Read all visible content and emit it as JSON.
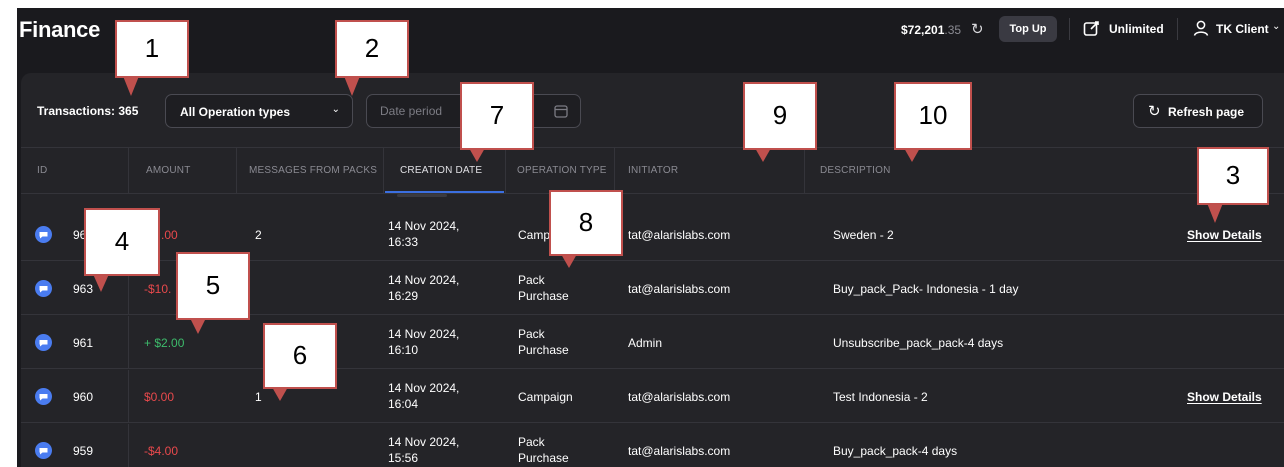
{
  "header": {
    "title": "Finance",
    "balance_main": "$72,201",
    "balance_cents": ".35",
    "topup_label": "Top Up",
    "plan_label": "Unlimited",
    "user_label": "TK Client"
  },
  "toolbar": {
    "transactions_label": "Transactions: 365",
    "operation_select_value": "All Operation types",
    "date_placeholder": "Date period",
    "refresh_label": "Refresh page"
  },
  "table": {
    "columns": [
      "ID",
      "AMOUNT",
      "MESSAGES FROM PACKS",
      "CREATION DATE",
      "OPERATION TYPE",
      "INITIATOR",
      "DESCRIPTION"
    ],
    "show_details_label": "Show Details",
    "rows": [
      {
        "id": "96",
        "amount": ".00",
        "amount_type": "negative",
        "messages": "2",
        "date": "14 Nov 2024,",
        "time": "16:33",
        "op_type": "Camp",
        "op_type2": "",
        "initiator": "tat@alarislabs.com",
        "description": "Sweden - 2",
        "details": true
      },
      {
        "id": "963",
        "amount": "-$10.",
        "amount_type": "negative",
        "messages": "",
        "date": "14 Nov 2024,",
        "time": "16:29",
        "op_type": "Pack",
        "op_type2": "Purchase",
        "initiator": "tat@alarislabs.com",
        "description": "Buy_pack_Pack- Indonesia - 1 day",
        "details": false
      },
      {
        "id": "961",
        "amount": "+ $2.00",
        "amount_type": "positive",
        "messages": "",
        "date": "14 Nov 2024,",
        "time": "16:10",
        "op_type": "Pack",
        "op_type2": "Purchase",
        "initiator": "Admin",
        "description": "Unsubscribe_pack_pack-4 days",
        "details": false
      },
      {
        "id": "960",
        "amount": "$0.00",
        "amount_type": "negative",
        "messages": "1",
        "date": "14 Nov 2024,",
        "time": "16:04",
        "op_type": "Campaign",
        "op_type2": "",
        "initiator": "tat@alarislabs.com",
        "description": "Test Indonesia - 2",
        "details": true
      },
      {
        "id": "959",
        "amount": "-$4.00",
        "amount_type": "negative",
        "messages": "",
        "date": "14 Nov 2024,",
        "time": "15:56",
        "op_type": "Pack",
        "op_type2": "Purchase",
        "initiator": "tat@alarislabs.com",
        "description": "Buy_pack_pack-4 days",
        "details": false
      }
    ]
  },
  "callouts": [
    "1",
    "2",
    "3",
    "4",
    "5",
    "6",
    "7",
    "8",
    "9",
    "10"
  ],
  "colors": {
    "background": "#1a1a1e",
    "panel": "#242428",
    "negative": "#e8494c",
    "positive": "#3dbb6b",
    "accent": "#3b6fe0",
    "callout_border": "#c0504d"
  },
  "icons": {
    "row_icon": "chat-bubble-icon",
    "refresh": "refresh-icon",
    "calendar": "calendar-icon",
    "plan": "plan-edit-icon",
    "user": "user-icon"
  }
}
